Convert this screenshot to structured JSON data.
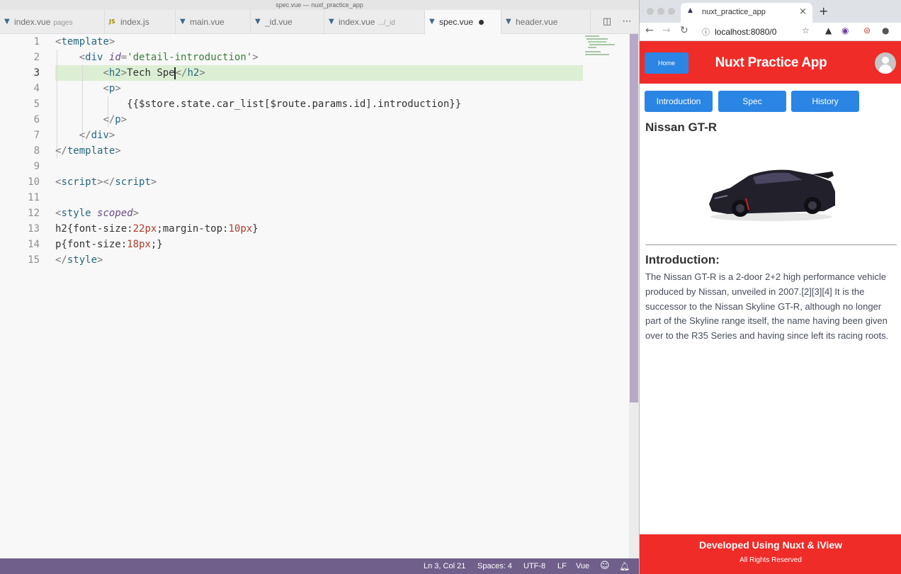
{
  "editor": {
    "window_title": "spec.vue — nuxt_practice_app",
    "tabs": [
      {
        "label": "index.vue",
        "hint": "pages",
        "icon": "vue-icon"
      },
      {
        "label": "index.js",
        "hint": "",
        "icon": "js-icon"
      },
      {
        "label": "main.vue",
        "hint": "",
        "icon": "vue-icon"
      },
      {
        "label": "_id.vue",
        "hint": "",
        "icon": "vue-icon"
      },
      {
        "label": "index.vue",
        "hint": ".../_id",
        "icon": "vue-icon"
      },
      {
        "label": "spec.vue",
        "hint": "",
        "icon": "vue-icon",
        "active": true,
        "modified": true
      },
      {
        "label": "header.vue",
        "hint": "",
        "icon": "vue-icon"
      }
    ],
    "line_numbers": [
      "1",
      "2",
      "3",
      "4",
      "5",
      "6",
      "7",
      "8",
      "9",
      "10",
      "11",
      "12",
      "13",
      "14",
      "15"
    ],
    "code": {
      "l1_tag": "template",
      "l2_tag": "div",
      "l2_attr": "id",
      "l2_val": "'detail-introduction'",
      "l3_tag": "h2",
      "l3_text": "Tech Spe",
      "l3_close": "h2",
      "l4_tag": "p",
      "l5_text": "{{$store.state.car_list[$route.params.id].introduction}}",
      "l6_tag": "p",
      "l7_tag": "div",
      "l8_tag": "template",
      "l10_open": "script",
      "l10_close": "script",
      "l12_tag": "style",
      "l12_attr": "scoped",
      "l13_sel": "h2{font-size:",
      "l13_n1": "22",
      "l13_u1": "px",
      "l13_mid": ";margin-top:",
      "l13_n2": "10",
      "l13_u2": "px",
      "l13_end": "}",
      "l14_sel": "p{font-size:",
      "l14_n1": "18",
      "l14_u1": "px",
      "l14_end": ";}",
      "l15_tag": "style"
    },
    "status": {
      "position": "Ln 3, Col 21",
      "spaces": "Spaces: 4",
      "encoding": "UTF-8",
      "eol": "LF",
      "language": "Vue"
    }
  },
  "browser": {
    "tab_title": "nuxt_practice_app",
    "url": "localhost:8080/0",
    "site": {
      "home_label": "Home",
      "title": "Nuxt Practice App",
      "nav": [
        "Introduction",
        "Spec",
        "History"
      ],
      "car_name": "Nissan GT-R",
      "intro_heading": "Introduction:",
      "intro_text": "The Nissan GT-R is a 2-door 2+2 high performance vehicle produced by Nissan, unveiled in 2007.[2][3][4] It is the successor to the Nissan Skyline GT-R, although no longer part of the Skyline range itself, the name having been given over to the R35 Series and having since left its racing roots.",
      "footer_title": "Developed Using Nuxt & iView",
      "footer_sub": "All Rights Reserved"
    }
  },
  "colors": {
    "header_red": "#ef2c28",
    "button_blue": "#2b85e4",
    "statusbar_purple": "#6f5f8a",
    "line_highlight": "#dcefd4"
  }
}
